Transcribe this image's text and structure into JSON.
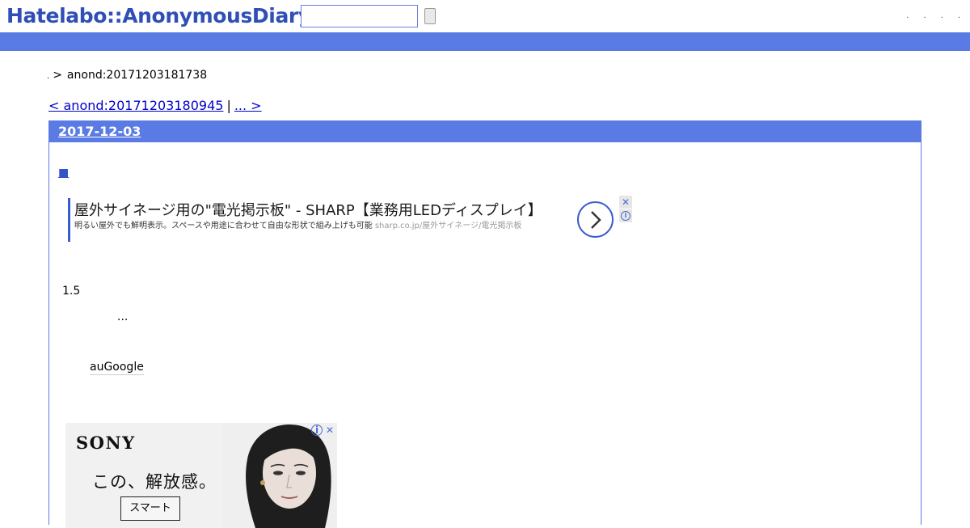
{
  "header": {
    "logo": "Hatelabo::AnonymousDiary",
    "search_placeholder": "",
    "links": [
      ".",
      ".",
      ".",
      "."
    ]
  },
  "breadcrumb": {
    "home": ".",
    "separator": ">",
    "current": "anond:20171203181738"
  },
  "pager": {
    "prev": "< anond:20171203180945",
    "separator": "|",
    "next": "... > "
  },
  "day": {
    "date": "2017-12-03",
    "section_marker": "■"
  },
  "text_ad": {
    "title": "屋外サイネージ用の\"電光掲示板\" - SHARP【業務用LEDディスプレイ】",
    "description": "明るい屋外でも鮮明表示。スペースや用途に合わせて自由な形状で組み上げも可能",
    "url": "sharp.co.jp/屋外サイネージ/電光掲示板",
    "arrow_icon": "chevron-right-icon",
    "close_label": "✕",
    "info_label": "i"
  },
  "body": {
    "line1": "1.5",
    "line2": "...",
    "line3": "auGoogle"
  },
  "display_ad": {
    "brand": "SONY",
    "headline": "この、解放感。",
    "sub": "スマート",
    "close_label": "✕",
    "info_label": "i"
  },
  "colors": {
    "accent_blue": "#5a7be3",
    "logo_blue": "#2f4fb6",
    "link_blue": "#0000cc"
  }
}
